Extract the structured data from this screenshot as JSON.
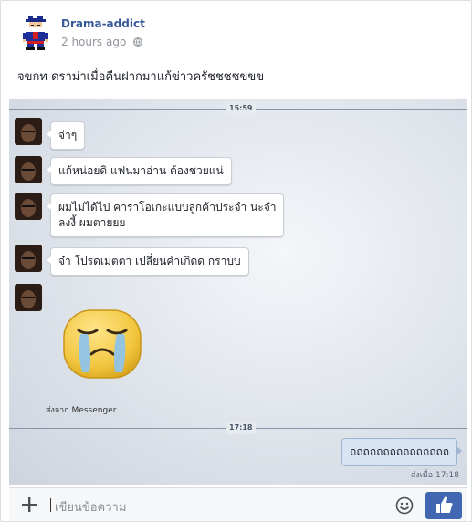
{
  "post": {
    "author": "Drama-addict",
    "time": "2 hours ago",
    "privacy_icon": "globe-icon",
    "caption": "จขกท ดราม่าเมื่อคืนฝากมาแก้ข่าวครัชชชชขขข"
  },
  "chat": {
    "timestamp_top": "15:59",
    "messages": [
      {
        "text": "จ๋าๆ"
      },
      {
        "text": "แก้หน่อยดิ แฟนมาอ่าน ต้องชวยแน่"
      },
      {
        "line1": "ผมไม่ได้ไป คาราโอเกะแบบลูกค้าประจำ นะจ๋า",
        "line2": "ลงงี้ ผมตายยย"
      },
      {
        "text": "จ๋า โปรดเมตตา เปลี่ยนคำเกิดด กราบบ"
      }
    ],
    "sticker": "crying-face-sticker",
    "sent_via": "ส่งจาก Messenger",
    "timestamp_bottom": "17:18",
    "sent_message": "ถถถถถถถถถถถถถถถ",
    "read_receipt": "ส่งเมื่อ 17:18"
  },
  "composer": {
    "placeholder": "เขียนข้อความ",
    "icons": [
      "plus-icon",
      "smile-icon",
      "thumbs-up-icon"
    ]
  },
  "colors": {
    "accent": "#4267b2",
    "link": "#365899",
    "sent_bubble": "#d8e4f3"
  }
}
